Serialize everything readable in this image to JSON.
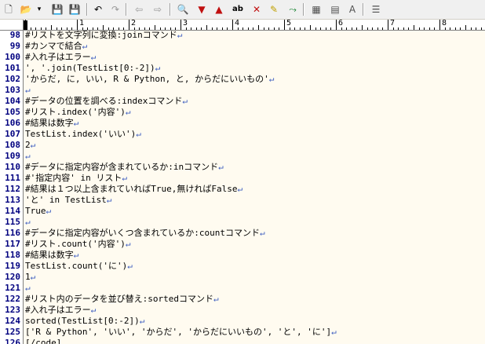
{
  "toolbar": {
    "icons": [
      {
        "name": "new-file-icon",
        "glyph": "🗋",
        "color": "#333333"
      },
      {
        "name": "open-folder-icon",
        "glyph": "📂",
        "color": "#d9a520"
      },
      {
        "name": "dropdown-arrow-icon",
        "glyph": "▾",
        "color": "#000000"
      },
      {
        "name": "save-icon",
        "glyph": "💾",
        "color": "#1a4fa0"
      },
      {
        "name": "save-as-icon",
        "glyph": "💾",
        "color": "#a01a8a"
      },
      {
        "name": "undo-icon",
        "glyph": "↶",
        "color": "#000000"
      },
      {
        "name": "redo-icon",
        "glyph": "↷",
        "color": "#999999"
      },
      {
        "name": "back-icon",
        "glyph": "⇦",
        "color": "#999999"
      },
      {
        "name": "forward-icon",
        "glyph": "⇨",
        "color": "#999999"
      },
      {
        "name": "search-icon",
        "glyph": "🔍",
        "color": "#333333"
      },
      {
        "name": "search-down-icon",
        "glyph": "▼",
        "color": "#c01010"
      },
      {
        "name": "search-up-icon",
        "glyph": "▲",
        "color": "#c01010"
      },
      {
        "name": "replace-icon",
        "glyph": "ab",
        "color": "#000000"
      },
      {
        "name": "clear-highlight-icon",
        "glyph": "✕",
        "color": "#c01010"
      },
      {
        "name": "highlight-icon",
        "glyph": "✎",
        "color": "#c0a000"
      },
      {
        "name": "jump-icon",
        "glyph": "⤳",
        "color": "#10802a"
      },
      {
        "name": "settings-icon",
        "glyph": "▦",
        "color": "#505050"
      },
      {
        "name": "type-settings-icon",
        "glyph": "▤",
        "color": "#505050"
      },
      {
        "name": "font-icon",
        "glyph": "A",
        "color": "#505050"
      },
      {
        "name": "outline-icon",
        "glyph": "☰",
        "color": "#505050"
      }
    ]
  },
  "ruler": {
    "labels": [
      "1",
      "2",
      "3",
      "4",
      "5",
      "6",
      "7",
      "8"
    ]
  },
  "lines": [
    {
      "num": "98",
      "text": "#リストを文字列に変換:joinコマンド",
      "nl": "↵"
    },
    {
      "num": "99",
      "text": "#カンマで結合",
      "nl": "↵"
    },
    {
      "num": "100",
      "text": "#入れ子はエラー",
      "nl": "↵"
    },
    {
      "num": "101",
      "text": "', '.join(TestList[0:-2])",
      "nl": "↵"
    },
    {
      "num": "102",
      "text": "'からだ, に, いい, R & Python, と, からだにいいもの'",
      "nl": "↵"
    },
    {
      "num": "103",
      "text": "",
      "nl": "↵"
    },
    {
      "num": "104",
      "text": "#データの位置を調べる:indexコマンド",
      "nl": "↵"
    },
    {
      "num": "105",
      "text": "#リスト.index('内容')",
      "nl": "↵"
    },
    {
      "num": "106",
      "text": "#結果は数字",
      "nl": "↵"
    },
    {
      "num": "107",
      "text": "TestList.index('いい')",
      "nl": "↵"
    },
    {
      "num": "108",
      "text": "2",
      "nl": "↵"
    },
    {
      "num": "109",
      "text": "",
      "nl": "↵"
    },
    {
      "num": "110",
      "text": "#データに指定内容が含まれているか:inコマンド",
      "nl": "↵"
    },
    {
      "num": "111",
      "text": "#'指定内容' in リスト",
      "nl": "↵"
    },
    {
      "num": "112",
      "text": "#結果は１つ以上含まれていればTrue,無ければFalse",
      "nl": "↵"
    },
    {
      "num": "113",
      "text": "'と' in TestList",
      "nl": "↵"
    },
    {
      "num": "114",
      "text": "True",
      "nl": "↵"
    },
    {
      "num": "115",
      "text": "",
      "nl": "↵"
    },
    {
      "num": "116",
      "text": "#データに指定内容がいくつ含まれているか:countコマンド",
      "nl": "↵"
    },
    {
      "num": "117",
      "text": "#リスト.count('内容')",
      "nl": "↵"
    },
    {
      "num": "118",
      "text": "#結果は数字",
      "nl": "↵"
    },
    {
      "num": "119",
      "text": "TestList.count('に')",
      "nl": "↵"
    },
    {
      "num": "120",
      "text": "1",
      "nl": "↵"
    },
    {
      "num": "121",
      "text": "",
      "nl": "↵"
    },
    {
      "num": "122",
      "text": "#リスト内のデータを並び替え:sortedコマンド",
      "nl": "↵"
    },
    {
      "num": "123",
      "text": "#入れ子はエラー",
      "nl": "↵"
    },
    {
      "num": "124",
      "text": "sorted(TestList[0:-2])",
      "nl": "↵"
    },
    {
      "num": "125",
      "text": "['R & Python', 'いい', 'からだ', 'からだにいいもの', 'と', 'に']",
      "nl": "↵"
    },
    {
      "num": "126",
      "text": "[/code]",
      "nl": ""
    }
  ]
}
